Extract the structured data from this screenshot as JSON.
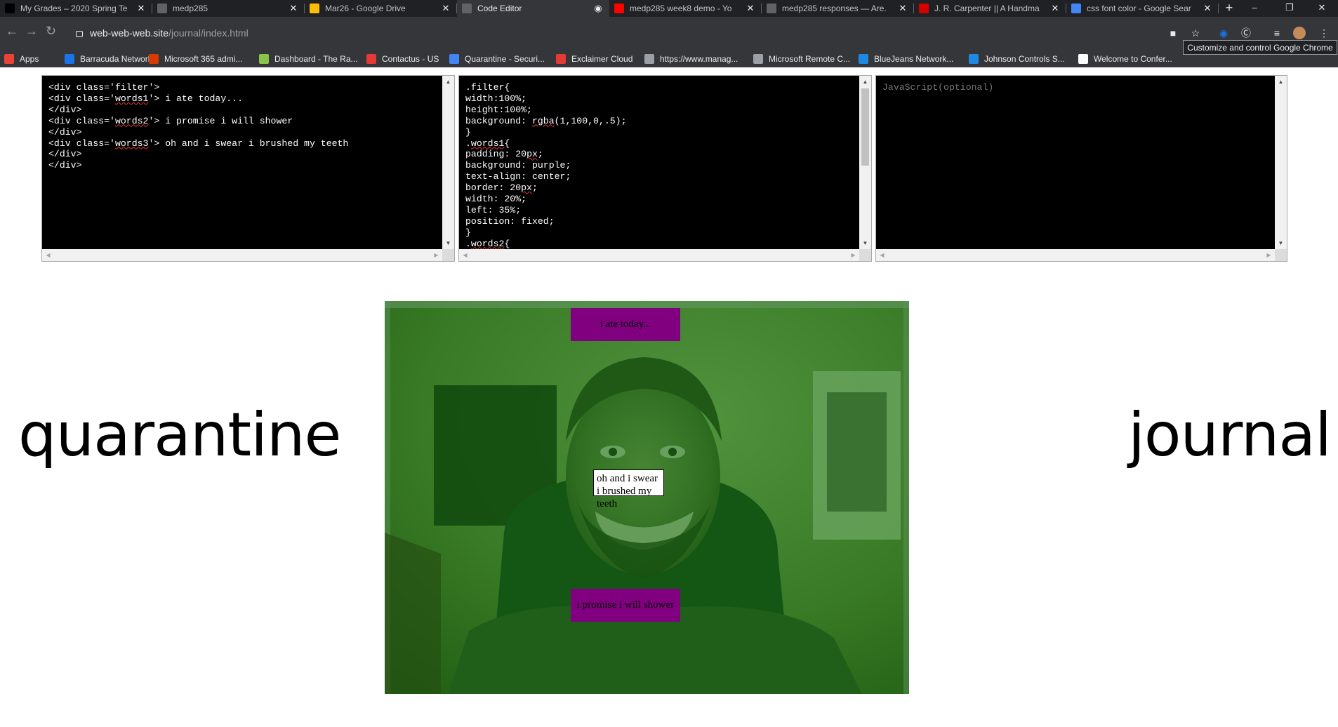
{
  "browser": {
    "tabs": [
      {
        "title": "My Grades – 2020 Spring Te",
        "icon": "blackboard-icon",
        "color": "#000000"
      },
      {
        "title": "medp285",
        "icon": "globe-icon",
        "color": "#5f6368"
      },
      {
        "title": "Mar26 - Google Drive",
        "icon": "drive-icon",
        "color": "#fbbc04"
      },
      {
        "title": "Code Editor",
        "icon": "globe-icon",
        "color": "#5f6368",
        "active": true
      },
      {
        "title": "medp285 week8 demo - Yo",
        "icon": "youtube-icon",
        "color": "#ff0000"
      },
      {
        "title": "medp285 responses — Are.",
        "icon": "are-na-icon",
        "color": "#5f6368"
      },
      {
        "title": "J. R. Carpenter || A Handma",
        "icon": "jrc-icon",
        "color": "#d50000"
      },
      {
        "title": "css font color - Google Sear",
        "icon": "google-icon",
        "color": "#4285f4"
      }
    ],
    "new_tab": "+",
    "window_controls": {
      "minimize": "–",
      "restore": "❐",
      "close": "✕"
    },
    "url": {
      "host": "web-web-web.site",
      "path": "/journal/index.html"
    },
    "tooltip": "Customize and control Google Chrome",
    "bookmarks": [
      {
        "label": "Apps",
        "icon": "apps-grid-icon",
        "color": "#ea4335"
      },
      {
        "label": "Barracuda Networks",
        "icon": "barracuda-icon",
        "color": "#1a73e8"
      },
      {
        "label": "Microsoft 365 admi...",
        "icon": "office-icon",
        "color": "#d83b01"
      },
      {
        "label": "Dashboard - The Ra...",
        "icon": "dashboard-icon",
        "color": "#8bc34a"
      },
      {
        "label": "Contactus - US",
        "icon": "l-icon",
        "color": "#e53935"
      },
      {
        "label": "Quarantine - Securi...",
        "icon": "shield-icon",
        "color": "#4285f4"
      },
      {
        "label": "Exclaimer Cloud",
        "icon": "exclaimer-icon",
        "color": "#e53935"
      },
      {
        "label": "https://www.manag...",
        "icon": "globe-icon",
        "color": "#9aa0a6"
      },
      {
        "label": "Microsoft Remote C...",
        "icon": "globe-icon",
        "color": "#9aa0a6"
      },
      {
        "label": "BlueJeans Network...",
        "icon": "bluejeans-icon",
        "color": "#1e88e5"
      },
      {
        "label": "Johnson Controls S...",
        "icon": "johnson-icon",
        "color": "#1e88e5"
      },
      {
        "label": "Welcome to Confer...",
        "icon": "page-icon",
        "color": "#ffffff"
      }
    ]
  },
  "editors": {
    "html_code": "<div class='filter'>\n<div class='words1'> i ate today...\n</div>\n<div class='words2'> i promise i will shower\n</div>\n<div class='words3'> oh and i swear i brushed my teeth\n</div>\n</div>",
    "css_code": ".filter{\nwidth:100%;\nheight:100%;\nbackground: rgba(1,100,0,.5);\n}\n.words1{\npadding: 20px;\nbackground: purple;\ntext-align: center;\nborder: 20px;\nwidth: 20%;\nleft: 35%;\nposition: fixed;\n}\n.words2{",
    "js_placeholder": "JavaScript(optional)"
  },
  "page": {
    "left_word": "quarantine",
    "right_word": "journal",
    "words1": "i ate today...",
    "words2": "i promise i will shower",
    "words3": "oh and i swear i brushed my teeth",
    "filter_color": "rgba(1,100,0,.5)",
    "box_color": "#800080"
  }
}
